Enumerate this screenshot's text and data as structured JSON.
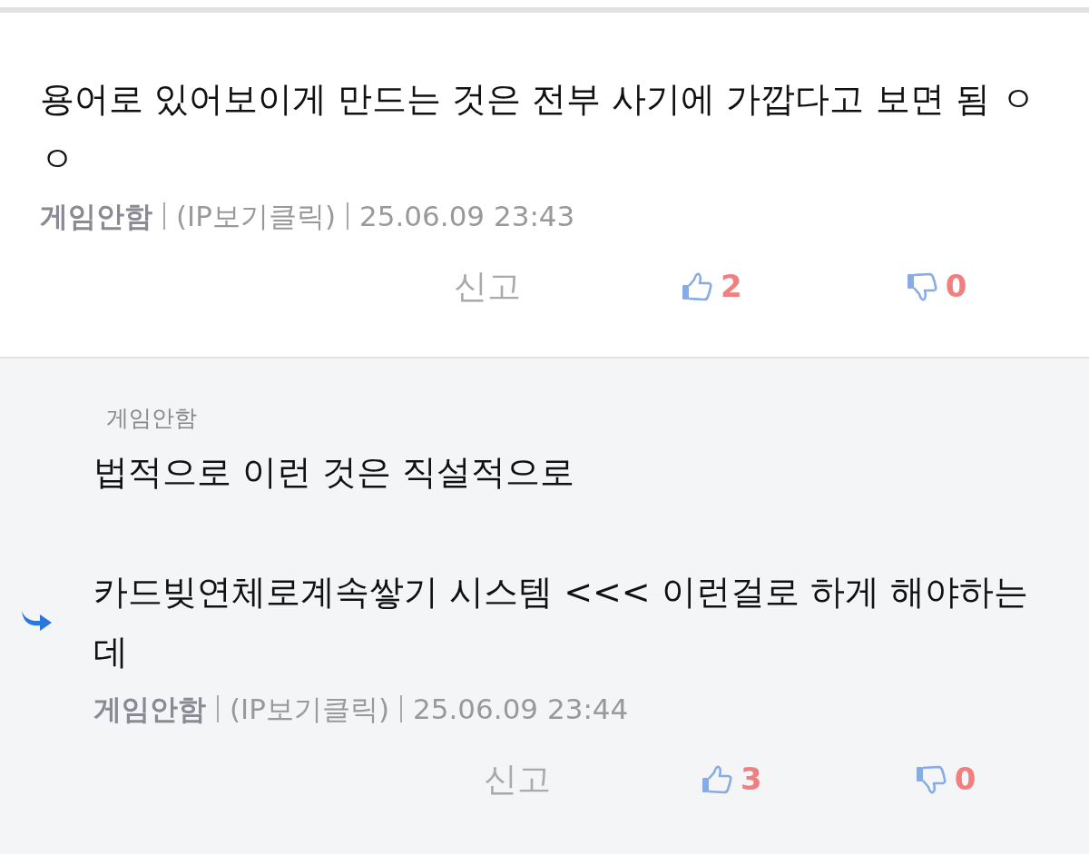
{
  "comments": [
    {
      "kind": "comment",
      "body": "용어로 있어보이게 만드는 것은 전부 사기에 가깝다고 보면 됨 ㅇㅇ",
      "author": "게임안함",
      "ip": "(IP보기클릭)",
      "date": "25.06.09 23:43",
      "report": "신고",
      "likes": "2",
      "dislikes": "0"
    },
    {
      "kind": "reply",
      "reply_to": "게임안함",
      "body": "법적으로 이런 것은 직설적으로\n\n카드빚연체로계속쌓기 시스템 <<< 이런걸로 하게 해야하는데",
      "author": "게임안함",
      "ip": "(IP보기클릭)",
      "date": "25.06.09 23:44",
      "report": "신고",
      "likes": "3",
      "dislikes": "0"
    }
  ]
}
